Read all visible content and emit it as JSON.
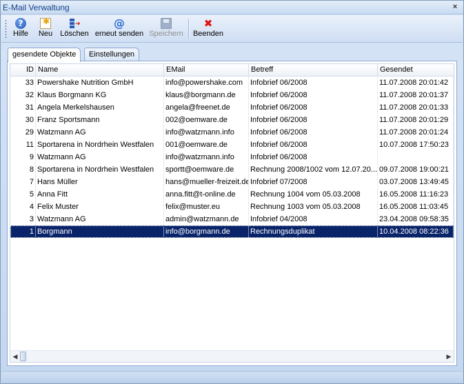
{
  "window": {
    "title": "E-Mail Verwaltung",
    "close_glyph": "×"
  },
  "toolbar": {
    "items": [
      {
        "label": "Hilfe",
        "icon": "help-icon",
        "glyph": "?"
      },
      {
        "label": "Neu",
        "icon": "new-document-icon"
      },
      {
        "label": "Löschen",
        "icon": "delete-icon"
      },
      {
        "label": "erneut senden",
        "icon": "at-sign-icon",
        "glyph": "@"
      },
      {
        "label": "Speichern",
        "icon": "save-icon",
        "disabled": true
      },
      {
        "label": "Beenden",
        "icon": "exit-icon",
        "glyph": "✖"
      }
    ]
  },
  "tabs": [
    {
      "label": "gesendete Objekte",
      "active": true
    },
    {
      "label": "Einstellungen",
      "active": false
    }
  ],
  "grid": {
    "columns": [
      "ID",
      "Name",
      "EMail",
      "Betreff",
      "Gesendet"
    ],
    "rows": [
      {
        "id": "33",
        "name": "Powershake Nutrition GmbH",
        "email": "info@powershake.com",
        "subject": "Infobrief 06/2008",
        "sent": "11.07.2008 20:01:42"
      },
      {
        "id": "32",
        "name": "Klaus Borgmann KG",
        "email": "klaus@borgmann.de",
        "subject": "Infobrief 06/2008",
        "sent": "11.07.2008 20:01:37"
      },
      {
        "id": "31",
        "name": "Angela Merkelshausen",
        "email": "angela@freenet.de",
        "subject": "Infobrief 06/2008",
        "sent": "11.07.2008 20:01:33"
      },
      {
        "id": "30",
        "name": "Franz Sportsmann",
        "email": "002@oemware.de",
        "subject": "Infobrief 06/2008",
        "sent": "11.07.2008 20:01:29"
      },
      {
        "id": "29",
        "name": "Watzmann AG",
        "email": "info@watzmann.info",
        "subject": "Infobrief 06/2008",
        "sent": "11.07.2008 20:01:24"
      },
      {
        "id": "11",
        "name": "Sportarena in Nordrhein Westfalen",
        "email": "001@oemware.de",
        "subject": "Infobrief 06/2008",
        "sent": "10.07.2008 17:50:23"
      },
      {
        "id": "9",
        "name": "Watzmann AG",
        "email": "info@watzmann.info",
        "subject": "Infobrief 06/2008",
        "sent": ""
      },
      {
        "id": "8",
        "name": "Sportarena in Nordrhein Westfalen",
        "email": "sportt@oemware.de",
        "subject": "Rechnung 2008/1002 vom 12.07.20...",
        "sent": "09.07.2008 19:00:21"
      },
      {
        "id": "7",
        "name": "Hans Müller",
        "email": "hans@mueller-freizeit.de",
        "subject": "Infobrief 07/2008",
        "sent": "03.07.2008 13:49:45"
      },
      {
        "id": "5",
        "name": "Anna Fitt",
        "email": "anna.fitt@t-online.de",
        "subject": "Rechnung 1004 vom 05.03.2008",
        "sent": "16.05.2008 11:16:23"
      },
      {
        "id": "4",
        "name": "Felix Muster",
        "email": "felix@muster.eu",
        "subject": "Rechnung 1003 vom 05.03.2008",
        "sent": "16.05.2008 11:03:45"
      },
      {
        "id": "3",
        "name": "Watzmann AG",
        "email": "admin@watzmann.de",
        "subject": "Infobrief 04/2008",
        "sent": "23.04.2008 09:58:35"
      },
      {
        "id": "1",
        "name": "Borgmann",
        "email": "info@borgmann.de",
        "subject": "Rechnungsduplikat",
        "sent": "10.04.2008 08:22:36",
        "selected": true
      }
    ]
  },
  "scrollbar": {
    "left_arrow": "◀",
    "right_arrow": "▶"
  }
}
